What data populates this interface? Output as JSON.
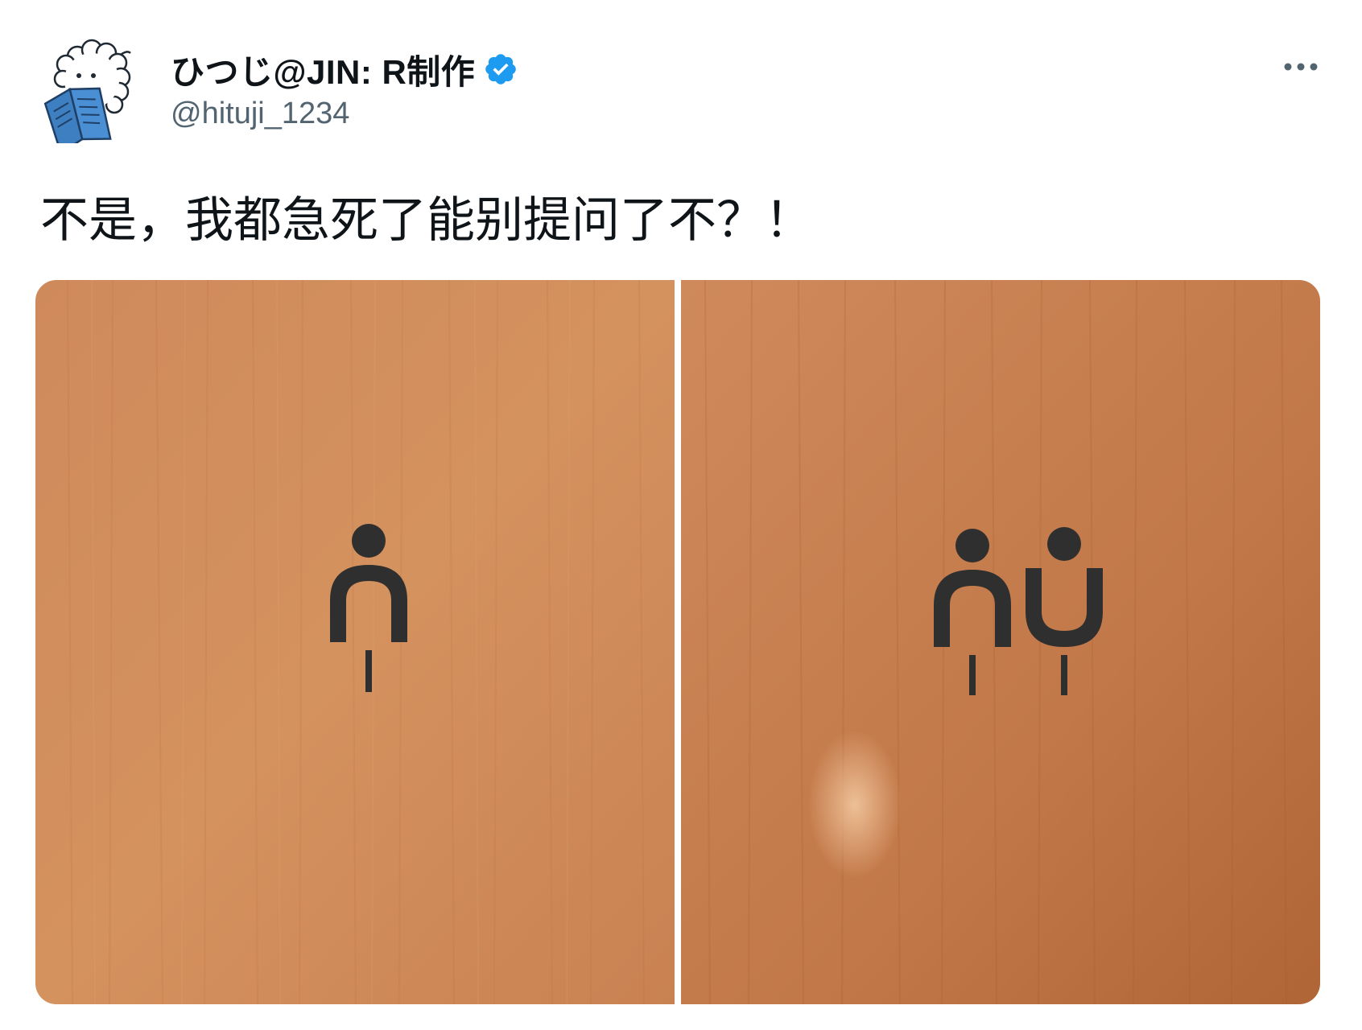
{
  "author": {
    "display_name": "ひつじ@JIN: R制作",
    "handle": "@hituji_1234",
    "avatar_icon": "sheep-reading-book-icon",
    "verified_icon": "verified-badge-icon"
  },
  "tweet": {
    "text": "不是，我都急死了能别提问了不？！",
    "more_icon": "more-options-icon"
  },
  "media": {
    "photos": [
      {
        "icon": "single-toilet-sign-icon"
      },
      {
        "icon": "double-toilet-sign-icon"
      }
    ]
  },
  "colors": {
    "text_primary": "#0f1419",
    "text_secondary": "#536471",
    "verified_blue": "#1d9bf0",
    "wood_light": "#d08a5a",
    "wood_dark": "#b86a3c",
    "sign_ink": "#2f2f2f"
  }
}
